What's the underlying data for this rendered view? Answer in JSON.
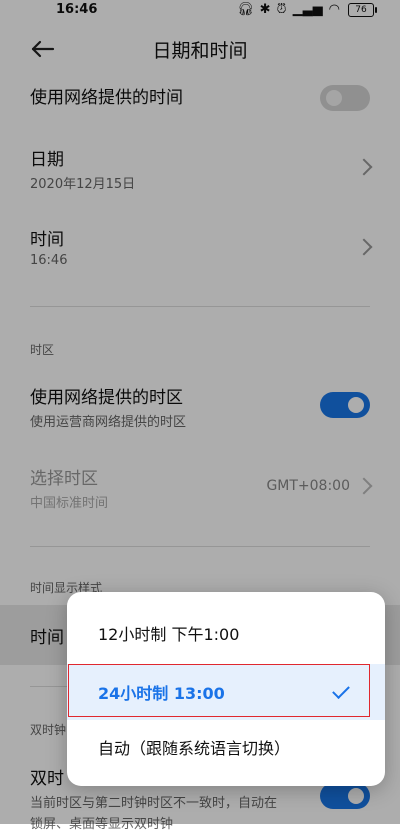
{
  "status_bar": {
    "time": "16:46",
    "battery": "76"
  },
  "header": {
    "title": "日期和时间"
  },
  "settings": {
    "network_time": {
      "title": "使用网络提供的时间",
      "enabled": false
    },
    "date": {
      "title": "日期",
      "value": "2020年12月15日"
    },
    "time": {
      "title": "时间",
      "value": "16:46"
    },
    "timezone_section": "时区",
    "network_timezone": {
      "title": "使用网络提供的时区",
      "subtitle": "使用运营商网络提供的时区",
      "enabled": true
    },
    "select_timezone": {
      "title": "选择时区",
      "subtitle": "中国标准时间",
      "value": "GMT+08:00"
    },
    "time_format_section": "时间显示样式",
    "time_format_row": {
      "title": "时间"
    },
    "dual_clock_section": "双时钟",
    "dual_clock": {
      "title": "双时",
      "subtitle_line1": "当前时区与第二时钟时区不一致时，自动在",
      "subtitle_line2": "锁屏、桌面等显示双时钟",
      "enabled": true
    }
  },
  "popup": {
    "options": [
      {
        "label": "12小时制 下午1:00",
        "selected": false
      },
      {
        "label": "24小时制 13:00",
        "selected": true
      },
      {
        "label": "自动（跟随系统语言切换）",
        "selected": false
      }
    ]
  },
  "colors": {
    "accent": "#1a73e8",
    "highlight_border": "#e0282e"
  }
}
